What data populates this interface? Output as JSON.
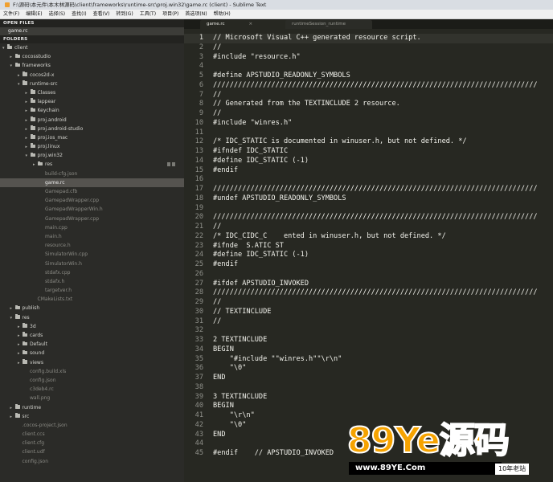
{
  "window": {
    "title": "F:\\源码\\本元件\\本木林源码\\client\\frameworks\\runtime-src\\proj.win32\\game.rc (client) - Sublime Text"
  },
  "menu": [
    "文件(F)",
    "编辑(E)",
    "选择(S)",
    "查找(I)",
    "查看(V)",
    "转到(G)",
    "工具(T)",
    "项目(P)",
    "首选项(N)",
    "帮助(H)"
  ],
  "sidebar": {
    "open_files_label": "OPEN FILES",
    "open_file": "game.rc",
    "folders_label": "FOLDERS",
    "tree": [
      {
        "label": "client",
        "depth": 0,
        "kind": "folder",
        "open": true
      },
      {
        "label": "cocosstudio",
        "depth": 1,
        "kind": "folder",
        "open": false
      },
      {
        "label": "frameworks",
        "depth": 1,
        "kind": "folder",
        "open": true
      },
      {
        "label": "cocos2d-x",
        "depth": 2,
        "kind": "folder",
        "open": false
      },
      {
        "label": "runtime-src",
        "depth": 2,
        "kind": "folder",
        "open": true
      },
      {
        "label": "Classes",
        "depth": 3,
        "kind": "folder",
        "open": false
      },
      {
        "label": "lappear",
        "depth": 3,
        "kind": "folder",
        "open": false
      },
      {
        "label": "Keychain",
        "depth": 3,
        "kind": "folder",
        "open": false
      },
      {
        "label": "proj.android",
        "depth": 3,
        "kind": "folder",
        "open": false
      },
      {
        "label": "proj.android-studio",
        "depth": 3,
        "kind": "folder",
        "open": false
      },
      {
        "label": "proj.ios_mac",
        "depth": 3,
        "kind": "folder",
        "open": false
      },
      {
        "label": "proj.linux",
        "depth": 3,
        "kind": "folder",
        "open": false
      },
      {
        "label": "proj.win32",
        "depth": 3,
        "kind": "folder",
        "open": true
      },
      {
        "label": "res",
        "depth": 4,
        "kind": "folder",
        "open": false
      },
      {
        "label": "build-cfg.json",
        "depth": 4,
        "kind": "file"
      },
      {
        "label": "game.rc",
        "depth": 4,
        "kind": "file",
        "selected": true
      },
      {
        "label": "Gamepad.cfb",
        "depth": 4,
        "kind": "file"
      },
      {
        "label": "GamepadWrapper.cpp",
        "depth": 4,
        "kind": "file"
      },
      {
        "label": "GamepadWrapperWin.h",
        "depth": 4,
        "kind": "file"
      },
      {
        "label": "GamepadWrapper.cpp",
        "depth": 4,
        "kind": "file"
      },
      {
        "label": "main.cpp",
        "depth": 4,
        "kind": "file"
      },
      {
        "label": "main.h",
        "depth": 4,
        "kind": "file"
      },
      {
        "label": "resource.h",
        "depth": 4,
        "kind": "file"
      },
      {
        "label": "SimulatorWin.cpp",
        "depth": 4,
        "kind": "file"
      },
      {
        "label": "SimulatorWin.h",
        "depth": 4,
        "kind": "file"
      },
      {
        "label": "stdafx.cpp",
        "depth": 4,
        "kind": "file"
      },
      {
        "label": "stdafx.h",
        "depth": 4,
        "kind": "file"
      },
      {
        "label": "targetver.h",
        "depth": 4,
        "kind": "file"
      },
      {
        "label": "CMakeLists.txt",
        "depth": 3,
        "kind": "file"
      },
      {
        "label": "publish",
        "depth": 1,
        "kind": "folder",
        "open": false
      },
      {
        "label": "res",
        "depth": 1,
        "kind": "folder",
        "open": true
      },
      {
        "label": "3d",
        "depth": 2,
        "kind": "folder",
        "open": false
      },
      {
        "label": "cards",
        "depth": 2,
        "kind": "folder",
        "open": false
      },
      {
        "label": "Default",
        "depth": 2,
        "kind": "folder",
        "open": false
      },
      {
        "label": "sound",
        "depth": 2,
        "kind": "folder",
        "open": false
      },
      {
        "label": "views",
        "depth": 2,
        "kind": "folder",
        "open": false
      },
      {
        "label": "config.build.xls",
        "depth": 2,
        "kind": "file"
      },
      {
        "label": "config.json",
        "depth": 2,
        "kind": "file"
      },
      {
        "label": "c3deb4.rc",
        "depth": 2,
        "kind": "file"
      },
      {
        "label": "wall.png",
        "depth": 2,
        "kind": "file"
      },
      {
        "label": "runtime",
        "depth": 1,
        "kind": "folder",
        "open": false
      },
      {
        "label": "src",
        "depth": 1,
        "kind": "folder",
        "open": false
      },
      {
        "label": ".cocos-project.json",
        "depth": 1,
        "kind": "file"
      },
      {
        "label": "client.ccs",
        "depth": 1,
        "kind": "file"
      },
      {
        "label": "client.cfg",
        "depth": 1,
        "kind": "file"
      },
      {
        "label": "client.udf",
        "depth": 1,
        "kind": "file"
      },
      {
        "label": "config.json",
        "depth": 1,
        "kind": "file"
      }
    ]
  },
  "tabs": [
    {
      "label": "game.rc",
      "active": true,
      "close": "×"
    },
    {
      "label": "runtimeSession_runtime",
      "active": false,
      "close": ""
    }
  ],
  "code": {
    "current_line": 1,
    "lines": [
      {
        "n": "1",
        "t": "// Microsoft Visual C++ generated resource script."
      },
      {
        "n": "2",
        "t": "//"
      },
      {
        "n": "3",
        "t": "#include \"resource.h\""
      },
      {
        "n": "4",
        "t": ""
      },
      {
        "n": "5",
        "t": "#define APSTUDIO_READONLY_SYMBOLS"
      },
      {
        "n": "6",
        "t": "//////////////////////////////////////////////////////////////////////////////"
      },
      {
        "n": "7",
        "t": "//"
      },
      {
        "n": "8",
        "t": "// Generated from the TEXTINCLUDE 2 resource."
      },
      {
        "n": "9",
        "t": "//"
      },
      {
        "n": "10",
        "t": "#include \"winres.h\""
      },
      {
        "n": "11",
        "t": ""
      },
      {
        "n": "12",
        "t": "/* IDC_STATIC is documented in winuser.h, but not defined. */"
      },
      {
        "n": "13",
        "t": "#ifndef IDC_STATIC"
      },
      {
        "n": "14",
        "t": "#define IDC_STATIC (-1)"
      },
      {
        "n": "15",
        "t": "#endif"
      },
      {
        "n": "16",
        "t": ""
      },
      {
        "n": "17",
        "t": "//////////////////////////////////////////////////////////////////////////////"
      },
      {
        "n": "18",
        "t": "#undef APSTUDIO_READONLY_SYMBOLS"
      },
      {
        "n": "19",
        "t": ""
      },
      {
        "n": "20",
        "t": "//////////////////////////////////////////////////////////////////////////////"
      },
      {
        "n": "21",
        "t": "//"
      },
      {
        "n": "22",
        "t": "/* IDC_CIDC_C    ented in winuser.h, but not defined. */"
      },
      {
        "n": "23",
        "t": "#ifnde  S.ATIC ST"
      },
      {
        "n": "24",
        "t": "#define IDC_STATIC (-1)"
      },
      {
        "n": "25",
        "t": "#endif"
      },
      {
        "n": "26",
        "t": ""
      },
      {
        "n": "27",
        "t": "#ifdef APSTUDIO_INVOKED"
      },
      {
        "n": "28",
        "t": "//////////////////////////////////////////////////////////////////////////////"
      },
      {
        "n": "29",
        "t": "//"
      },
      {
        "n": "30",
        "t": "// TEXTINCLUDE"
      },
      {
        "n": "31",
        "t": "//"
      },
      {
        "n": "32",
        "t": ""
      },
      {
        "n": "33",
        "t": "2 TEXTINCLUDE"
      },
      {
        "n": "34",
        "t": "BEGIN"
      },
      {
        "n": "35",
        "t": "    \"#include \"\"winres.h\"\"\\r\\n\""
      },
      {
        "n": "36",
        "t": "    \"\\0\""
      },
      {
        "n": "37",
        "t": "END"
      },
      {
        "n": "38",
        "t": ""
      },
      {
        "n": "39",
        "t": "3 TEXTINCLUDE"
      },
      {
        "n": "40",
        "t": "BEGIN"
      },
      {
        "n": "41",
        "t": "    \"\\r\\n\""
      },
      {
        "n": "42",
        "t": "    \"\\0\""
      },
      {
        "n": "43",
        "t": "END"
      },
      {
        "n": "44",
        "t": ""
      },
      {
        "n": "45",
        "t": "#endif    // APSTUDIO_INVOKED"
      }
    ]
  },
  "watermark": {
    "logo": "89Ye源码",
    "url": "www.89YE.Com",
    "tag": "10年老站"
  },
  "colors": {
    "editor_bg": "#272822",
    "sidebar_bg": "#2b2b28",
    "watermark_orange": "#f6a300"
  }
}
